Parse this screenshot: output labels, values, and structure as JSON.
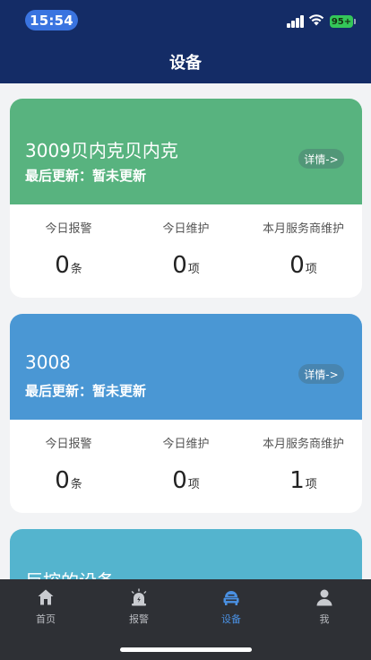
{
  "status_bar": {
    "time": "15:54",
    "battery": "95+"
  },
  "header": {
    "title": "设备"
  },
  "devices": [
    {
      "name": "3009贝内克贝内克",
      "last_update": "最后更新：暂未更新",
      "detail_label": "详情->",
      "color": "#58b37f",
      "stats": [
        {
          "label": "今日报警",
          "value": "0",
          "unit": "条"
        },
        {
          "label": "今日维护",
          "value": "0",
          "unit": "项"
        },
        {
          "label": "本月服务商维护",
          "value": "0",
          "unit": "项"
        }
      ]
    },
    {
      "name": "3008",
      "last_update": "最后更新：暂未更新",
      "detail_label": "详情->",
      "color": "#4a97d4",
      "stats": [
        {
          "label": "今日报警",
          "value": "0",
          "unit": "条"
        },
        {
          "label": "今日维护",
          "value": "0",
          "unit": "项"
        },
        {
          "label": "本月服务商维护",
          "value": "1",
          "unit": "项"
        }
      ]
    },
    {
      "name": "巨控的设备",
      "color": "#54b4ce"
    }
  ],
  "tabbar": {
    "items": [
      {
        "label": "首页",
        "icon": "home-icon"
      },
      {
        "label": "报警",
        "icon": "alarm-icon"
      },
      {
        "label": "设备",
        "icon": "device-icon",
        "active": true
      },
      {
        "label": "我",
        "icon": "person-icon"
      }
    ],
    "active_color": "#4a90e2"
  }
}
